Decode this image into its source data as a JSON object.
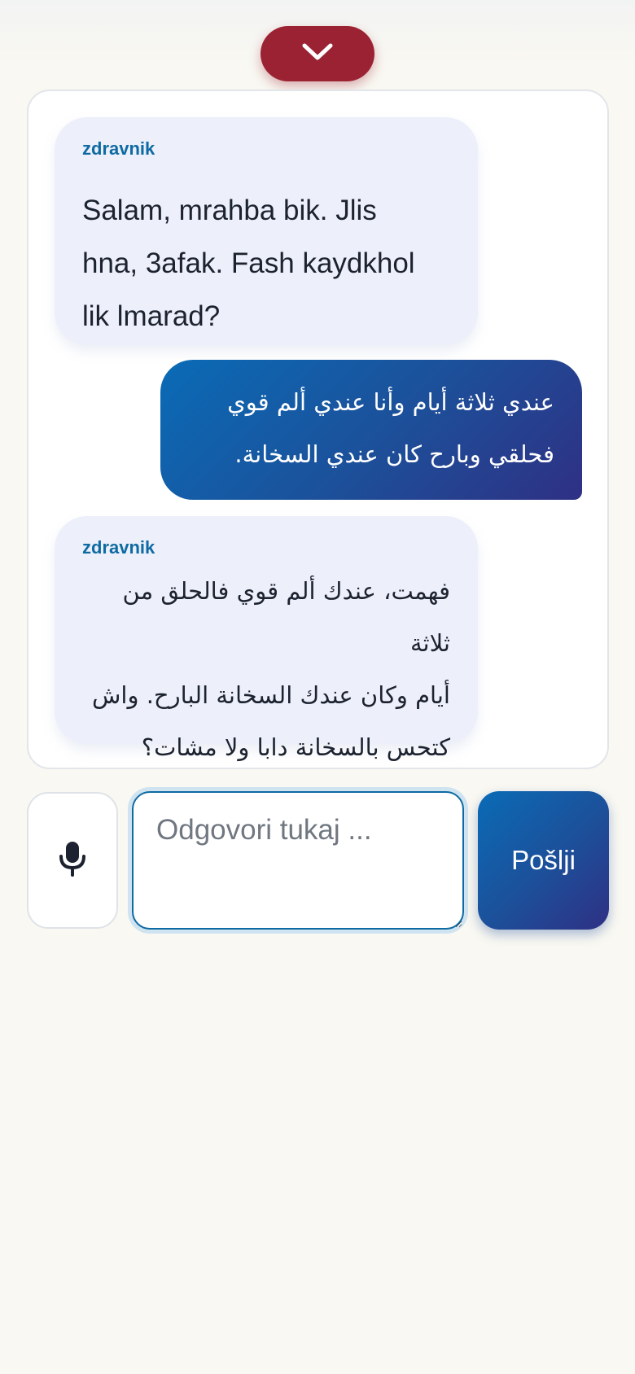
{
  "collapse_button": {
    "icon": "chevron-down-icon"
  },
  "messages": [
    {
      "role": "doctor",
      "sender": "zdravnik",
      "text_lines": [
        "Salam, mrahba bik. Jlis",
        "hna, 3afak. Fash kaydkhol",
        "lik lmarad?"
      ]
    },
    {
      "role": "patient",
      "text_lines": [
        "عندي ثلاثة أيام وأنا عندي ألم قوي",
        "فحلقي وبارح كان عندي السخانة."
      ]
    },
    {
      "role": "doctor",
      "sender": "zdravnik",
      "text_lines": [
        "فهمت، عندك ألم قوي فالحلق من ثلاثة",
        "أيام وكان عندك السخانة البارح. واش",
        "كتحس بالسخانة دابا ولا مشات؟"
      ]
    }
  ],
  "composer": {
    "mic_icon": "microphone-icon",
    "placeholder": "Odgovori tukaj ...",
    "value": "",
    "send_label": "Pošlji"
  },
  "colors": {
    "accent_red": "#9b2232",
    "accent_blue": "#0e6aa3",
    "gradient_start": "#0a6bb6",
    "gradient_end": "#2f3084",
    "incoming_bubble": "#edf0fa"
  }
}
